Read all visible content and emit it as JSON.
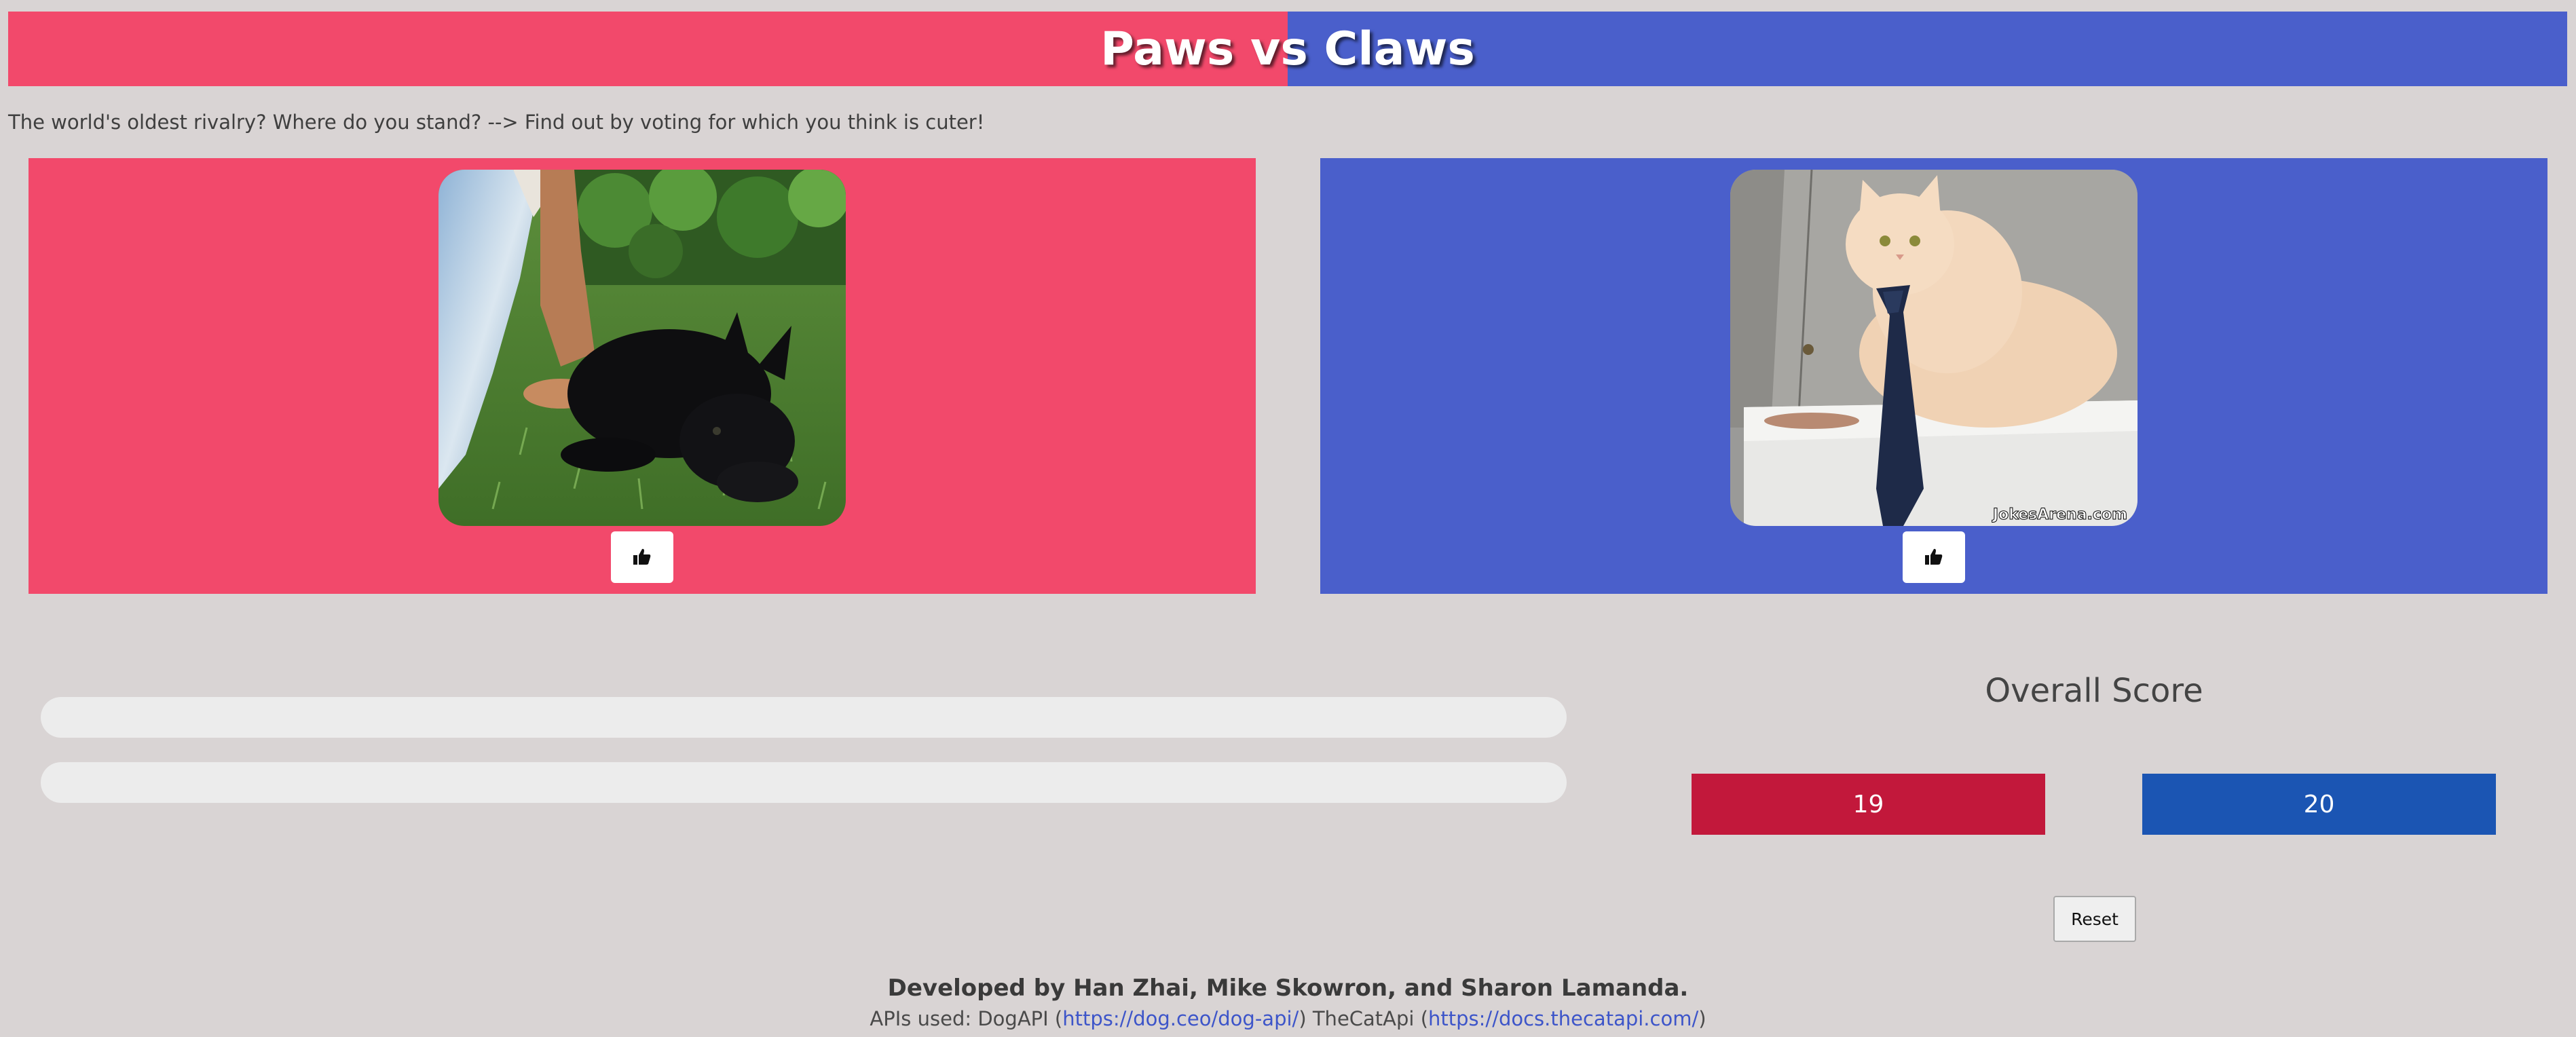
{
  "header": {
    "title": "Paws vs Claws",
    "left_color": "#f2496b",
    "right_color": "#4a5fcb"
  },
  "tagline": "The world's oldest rivalry? Where do you stand? --> Find out by voting for which you think is cuter!",
  "panels": {
    "dog": {
      "photo": "black puppy lying on grass",
      "vote_icon": "thumbs-up-icon"
    },
    "cat": {
      "photo": "cream cat wearing a necktie",
      "photo_watermark": "JokesArena.com",
      "vote_icon": "thumbs-up-icon"
    }
  },
  "progress": {
    "dog_fraction": 0,
    "cat_fraction": 0
  },
  "scoreboard": {
    "title": "Overall Score",
    "dog_score": "19",
    "cat_score": "20",
    "dog_color": "#c2183b",
    "cat_color": "#1b55b3"
  },
  "reset_label": "Reset",
  "footer": {
    "developers": "Developed by Han Zhai, Mike Skowron, and Sharon Lamanda.",
    "apis_prefix": "APIs used: DogAPI (",
    "dog_api_link": "https://dog.ceo/dog-api/",
    "apis_middle": ") TheCatApi (",
    "cat_api_link": "https://docs.thecatapi.com/",
    "apis_suffix": ")"
  }
}
